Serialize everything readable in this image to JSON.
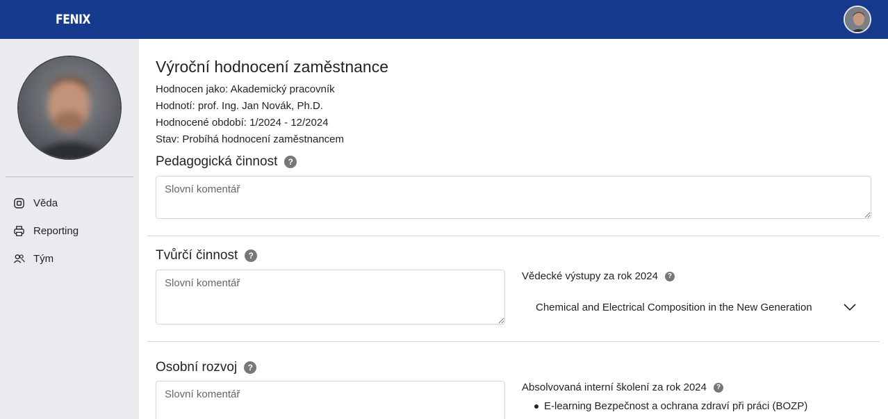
{
  "header": {
    "brand": "FENIX",
    "user_avatar_icon": "user-avatar"
  },
  "sidebar": {
    "profile_photo_icon": "profile-photo",
    "items": [
      {
        "label": "Věda",
        "icon": "chip-icon"
      },
      {
        "label": "Reporting",
        "icon": "printer-icon"
      },
      {
        "label": "Tým",
        "icon": "team-icon"
      }
    ]
  },
  "main": {
    "title": "Výroční hodnocení zaměstnance",
    "meta": [
      "Hodnocen jako: Akademický pracovník",
      "Hodnotí: prof. Ing. Jan Novák, Ph.D.",
      "Hodnocené období: 1/2024 - 12/2024",
      "Stav: Probíhá hodnocení zaměstnancem"
    ],
    "sections": {
      "pedagogical": {
        "title": "Pedagogická činnost",
        "placeholder": "Slovní komentář",
        "help": "?"
      },
      "creative": {
        "title": "Tvůrčí činnost",
        "placeholder": "Slovní komentář",
        "help": "?",
        "outputs_label": "Vědecké výstupy za rok 2024",
        "outputs_item": "Chemical and Electrical Composition in the New Generation"
      },
      "personal": {
        "title": "Osobní rozvoj",
        "placeholder": "Slovní komentář",
        "help": "?",
        "trainings_label": "Absolvovaná interní školení za rok 2024",
        "trainings": [
          "E-learning Bezpečnost a ochrana zdraví při práci (BOZP)"
        ]
      }
    }
  },
  "colors": {
    "header_bg": "#173b8c",
    "sidebar_bg": "#e9ebef",
    "help_icon": "#777777"
  }
}
